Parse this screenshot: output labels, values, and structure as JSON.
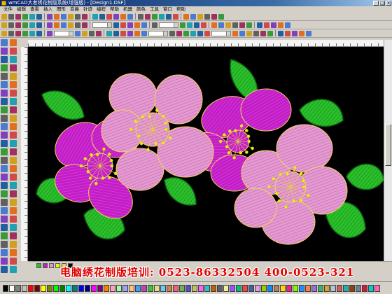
{
  "window": {
    "title": "wmCAD大者绣花制版系统(增强版) - [Design1.DSF]",
    "buttons": [
      "_",
      "□",
      "×"
    ]
  },
  "menu": [
    "文件",
    "编辑",
    "查看",
    "插入",
    "图形",
    "变换",
    "针迹",
    "编程",
    "帮助",
    "机器",
    "颜色",
    "工具",
    "窗口",
    "帮助"
  ],
  "banner": {
    "text": "电脑绣花制版培训: 0523-86332504  400-0523-321"
  },
  "toolbar_icons": [
    "new-icon",
    "open-icon",
    "save-icon",
    "print-icon",
    "cut-icon",
    "copy-icon",
    "paste-icon",
    "undo-icon",
    "redo-icon",
    "zoom-icon"
  ],
  "palette": [
    "#000000",
    "#ffffff",
    "#808080",
    "#c0c0c0",
    "#ff0000",
    "#800000",
    "#ffff00",
    "#808000",
    "#00ff00",
    "#008000",
    "#00ffff",
    "#008080",
    "#0000ff",
    "#000080",
    "#ff00ff",
    "#800080",
    "#ff8000",
    "#ffa0c0",
    "#a0ffa0",
    "#a0a0ff",
    "#ffc080",
    "#40a0ff",
    "#c040c0",
    "#40c040",
    "#e0e080",
    "#60d0ff",
    "#d08040",
    "#f06080",
    "#70b050",
    "#5050c0",
    "#c0c060",
    "#ff60ff",
    "#30c0c0",
    "#c06000",
    "#606060",
    "#f0f0a0",
    "#a050ff",
    "#00c080",
    "#ff4040",
    "#4060a0",
    "#e0a0e0",
    "#90d000",
    "#0090ff",
    "#b08060",
    "#ffd700",
    "#ff1493",
    "#7cfc00",
    "#1e90ff",
    "#ff7f50",
    "#9370db",
    "#3cb371",
    "#daa520",
    "#b0c4de",
    "#cd5c5c",
    "#20b2aa",
    "#8b4513",
    "#708090",
    "#dc143c",
    "#00ced1",
    "#ff69b4"
  ],
  "colors": {
    "leaf": "#2bc02b",
    "leaf_dark": "#0f7a12",
    "magenta": "#c21dc6",
    "magenta_light": "#e04ae0",
    "pink": "#e49ad0",
    "pink_dark": "#c06ab0",
    "stamen": "#f0f020",
    "outline": "#f5d25a"
  }
}
